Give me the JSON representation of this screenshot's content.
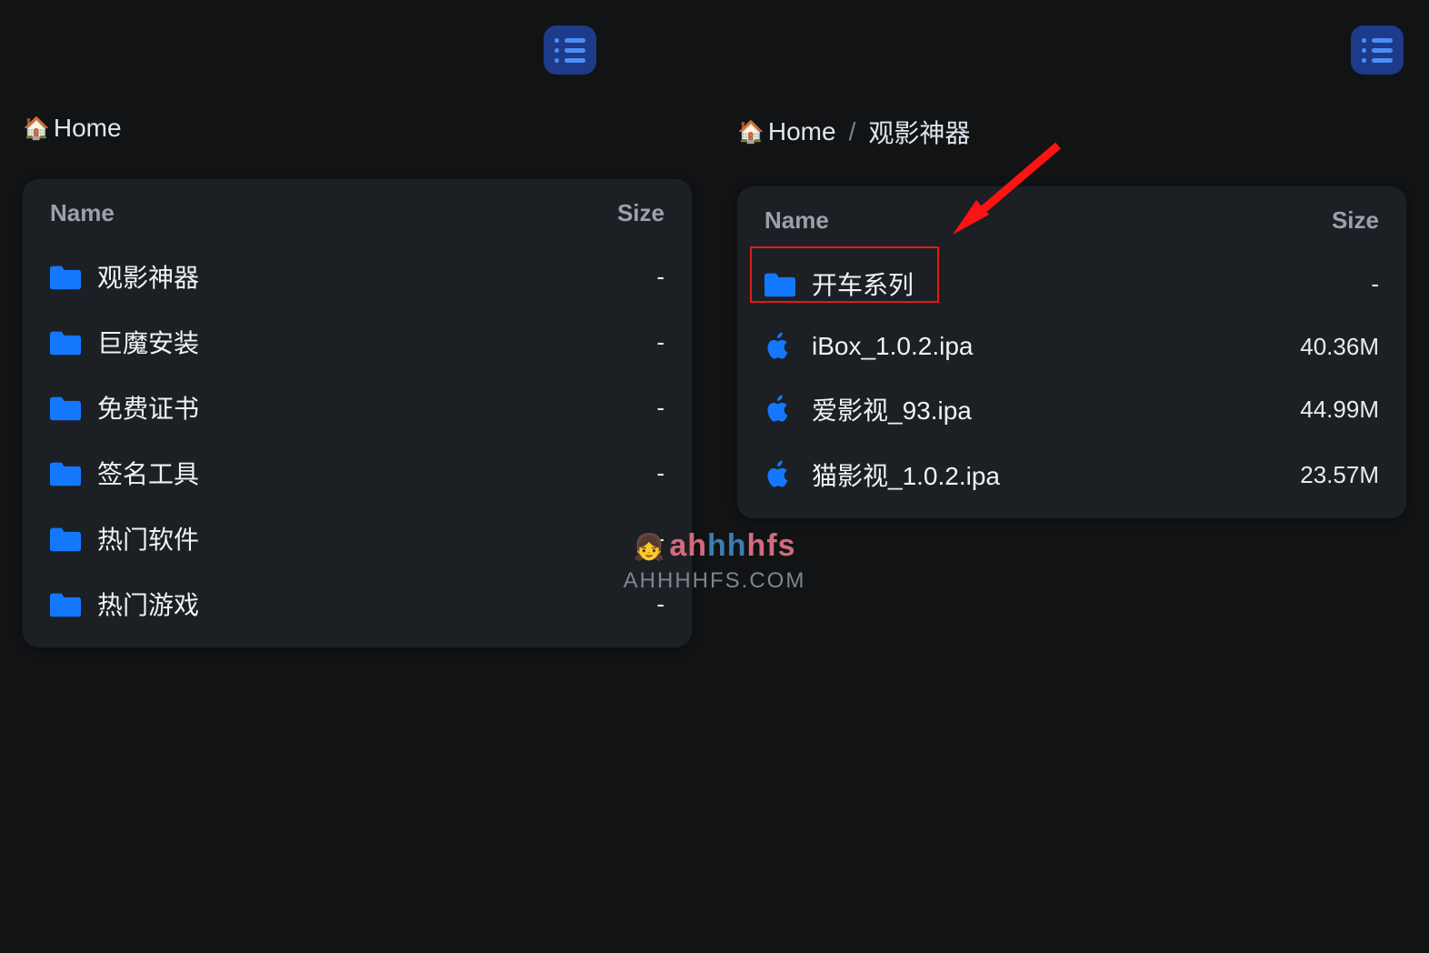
{
  "colors": {
    "folder": "#1478ff",
    "apple": "#1478ff",
    "highlight": "#e11a1a"
  },
  "left": {
    "breadcrumb": [
      {
        "icon": "house",
        "label": "Home"
      }
    ],
    "header": {
      "name": "Name",
      "size": "Size"
    },
    "items": [
      {
        "type": "folder",
        "name": "观影神器",
        "size": "-"
      },
      {
        "type": "folder",
        "name": "巨魔安装",
        "size": "-"
      },
      {
        "type": "folder",
        "name": "免费证书",
        "size": "-"
      },
      {
        "type": "folder",
        "name": "签名工具",
        "size": "-"
      },
      {
        "type": "folder",
        "name": "热门软件",
        "size": "-"
      },
      {
        "type": "folder",
        "name": "热门游戏",
        "size": "-"
      }
    ]
  },
  "right": {
    "breadcrumb": [
      {
        "icon": "house",
        "label": "Home"
      },
      {
        "sep": "/"
      },
      {
        "label": "观影神器"
      }
    ],
    "header": {
      "name": "Name",
      "size": "Size"
    },
    "items": [
      {
        "type": "folder",
        "name": "开车系列",
        "size": "-",
        "highlighted": true
      },
      {
        "type": "ipa",
        "name": "iBox_1.0.2.ipa",
        "size": "40.36M"
      },
      {
        "type": "ipa",
        "name": "爱影视_93.ipa",
        "size": "44.99M"
      },
      {
        "type": "ipa",
        "name": "猫影视_1.0.2.ipa",
        "size": "23.57M"
      }
    ]
  },
  "watermark": {
    "line1": "ahhhhfs",
    "line2": "AHHHHFS.COM"
  }
}
